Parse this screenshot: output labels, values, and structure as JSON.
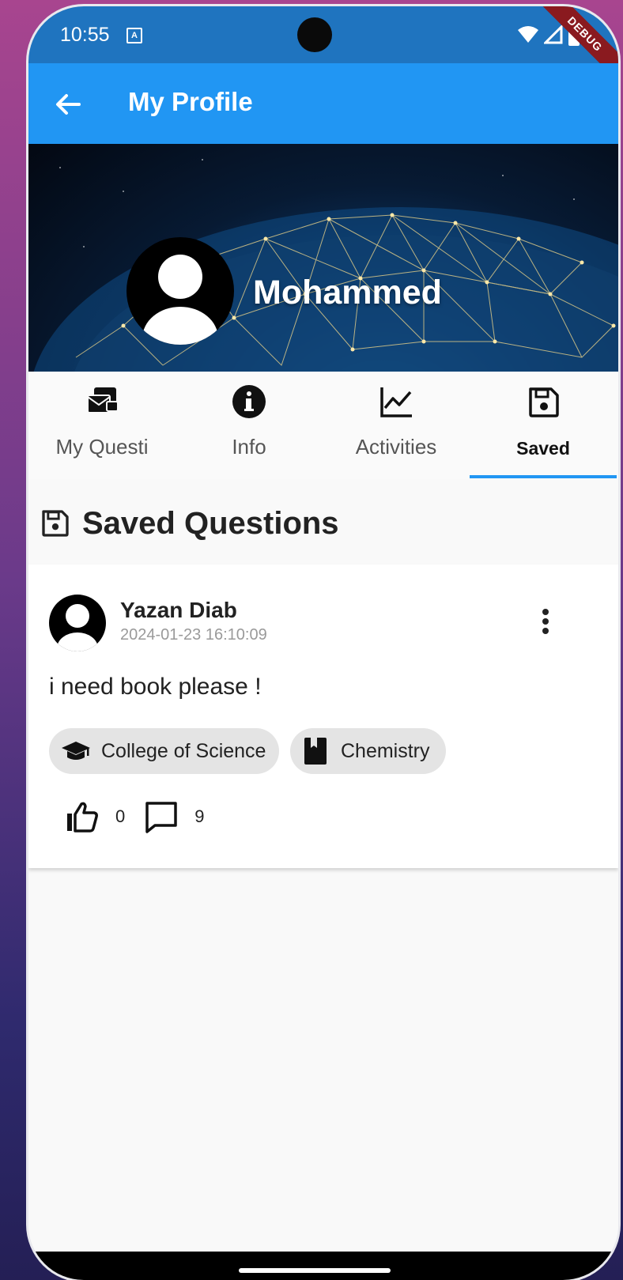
{
  "status_bar": {
    "time": "10:55",
    "badge": "A",
    "debug_label": "DEBUG"
  },
  "app_bar": {
    "title": "My Profile",
    "back_icon": "arrow-back-icon"
  },
  "profile": {
    "name": "Mohammed",
    "avatar_icon": "person-icon"
  },
  "tabs": [
    {
      "label": "My Questi",
      "icon": "questions-icon",
      "active": false
    },
    {
      "label": "Info",
      "icon": "info-icon",
      "active": false
    },
    {
      "label": "Activities",
      "icon": "chart-line-icon",
      "active": false
    },
    {
      "label": "Saved",
      "icon": "save-icon",
      "active": true
    }
  ],
  "section": {
    "title": "Saved Questions",
    "icon": "save-icon"
  },
  "questions": [
    {
      "author": "Yazan Diab",
      "date": "2024-01-23 16:10:09",
      "text": "i need book please !",
      "tags": [
        {
          "label": "College of Science",
          "icon": "graduation-cap-icon"
        },
        {
          "label": "Chemistry",
          "icon": "book-icon"
        }
      ],
      "likes": "0",
      "comments": "9"
    }
  ],
  "colors": {
    "primary": "#2196f3",
    "status_bar": "#1f74bf",
    "chip_bg": "#e4e4e4"
  }
}
